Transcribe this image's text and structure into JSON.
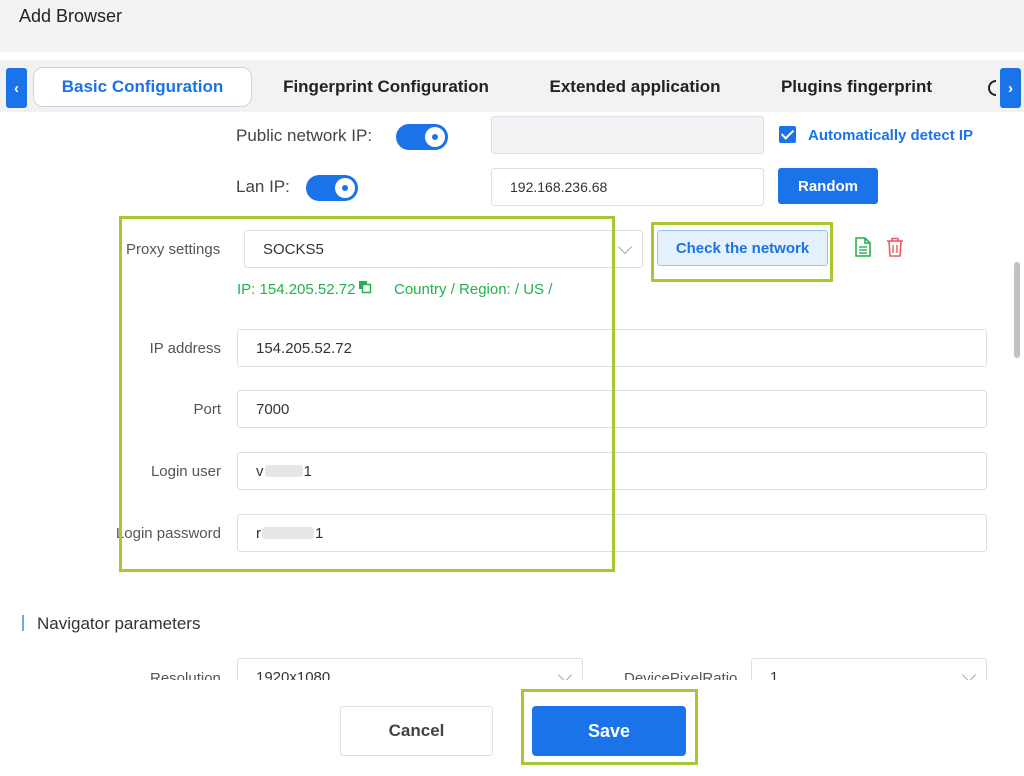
{
  "window": {
    "title": "Add Browser"
  },
  "tabs": [
    {
      "label": "Basic Configuration",
      "active": true
    },
    {
      "label": "Fingerprint Configuration"
    },
    {
      "label": "Extended application"
    },
    {
      "label": "Plugins fingerprint"
    }
  ],
  "network": {
    "public_ip_label": "Public network IP:",
    "public_ip_value": "",
    "auto_detect_label": "Automatically detect IP",
    "lan_ip_label": "Lan IP:",
    "lan_ip_value": "192.168.236.68",
    "random_label": "Random"
  },
  "proxy": {
    "settings_label": "Proxy settings",
    "type_value": "SOCKS5",
    "check_label": "Check the network",
    "ip_result": "IP: 154.205.52.72",
    "region_result": "Country / Region: / US /",
    "ip_address_label": "IP address",
    "ip_address_value": "154.205.52.72",
    "port_label": "Port",
    "port_value": "7000",
    "login_user_label": "Login user",
    "login_user_prefix": "v",
    "login_user_suffix": "1",
    "login_password_label": "Login password",
    "login_password_prefix": "r",
    "login_password_suffix": "1"
  },
  "navigator": {
    "section_title": "Navigator parameters",
    "resolution_label": "Resolution",
    "resolution_value": "1920x1080",
    "dpr_label": "DevicePixelRatio",
    "dpr_value": "1"
  },
  "footer": {
    "cancel_label": "Cancel",
    "save_label": "Save"
  },
  "colors": {
    "accent": "#1a73e8",
    "success": "#22b14c",
    "highlight": "#a5c935",
    "danger": "#f05a5a"
  },
  "icons": [
    "chevron-left-icon",
    "chevron-right-icon",
    "copy-icon",
    "document-icon",
    "trash-icon",
    "chevron-down-icon",
    "check-icon"
  ]
}
